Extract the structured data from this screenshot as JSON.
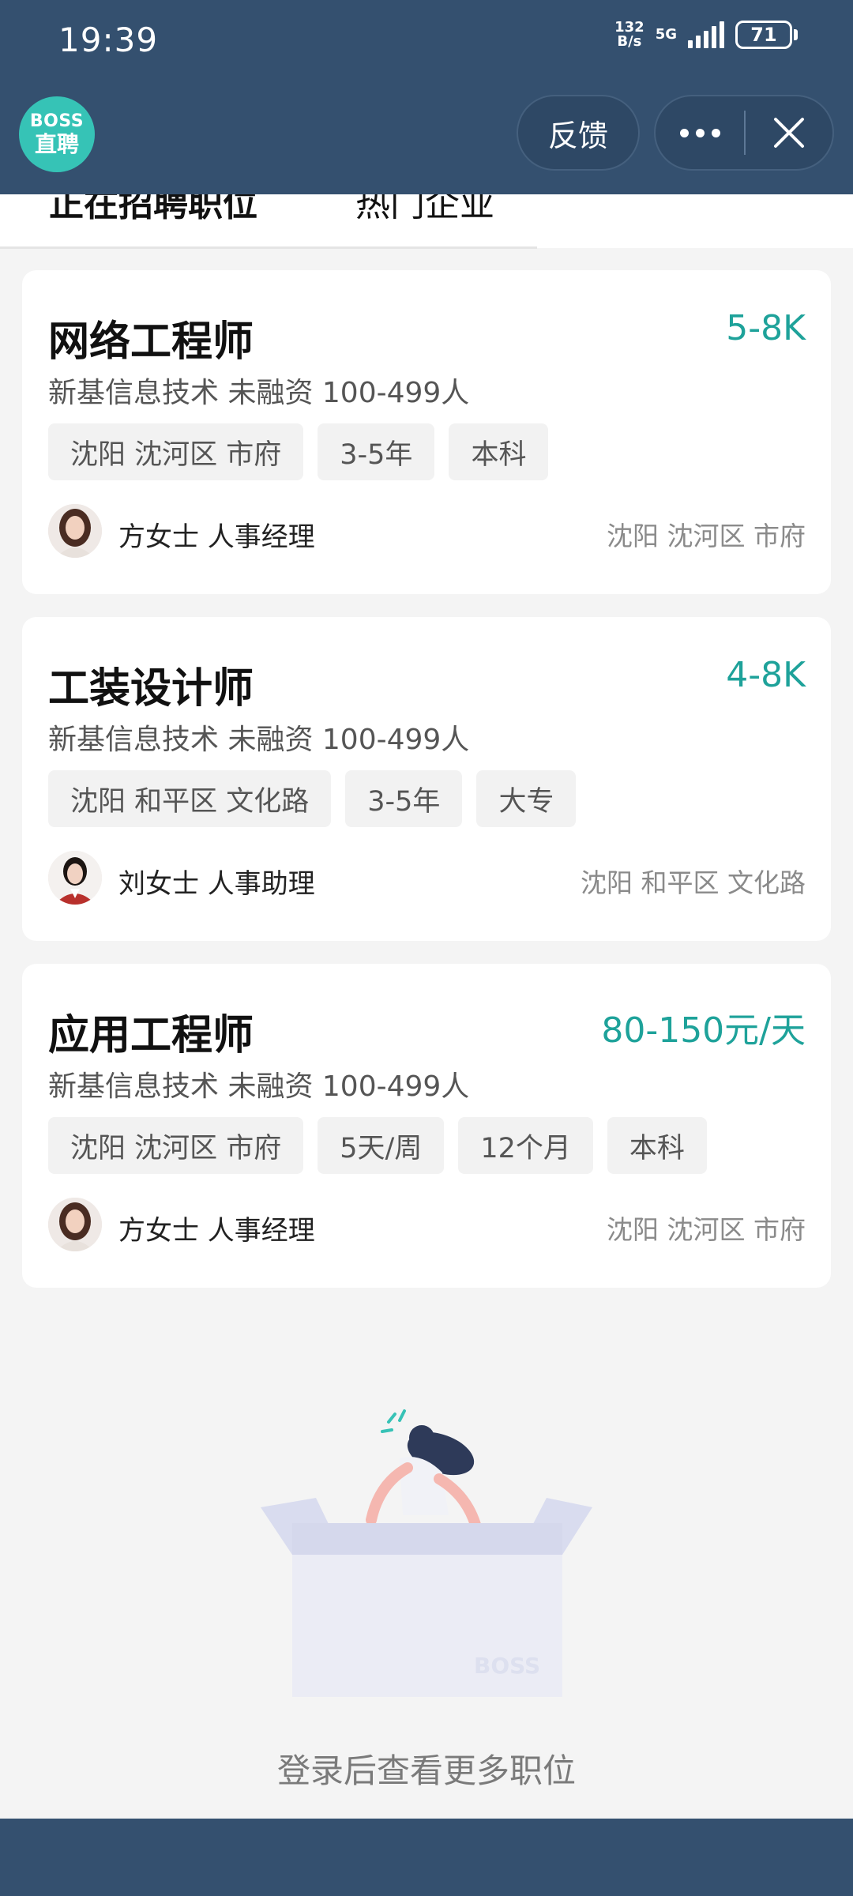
{
  "status_bar": {
    "time": "19:39",
    "net_speed_top": "132",
    "net_speed_bottom": "B/s",
    "network": "5G",
    "battery": "71"
  },
  "header": {
    "logo_line1": "BOSS",
    "logo_line2": "直聘",
    "feedback_label": "反馈",
    "more_icon": "more-dots-icon",
    "close_icon": "close-icon"
  },
  "tabs": [
    {
      "label": "正在招聘职位",
      "active": true
    },
    {
      "label": "热门企业",
      "active": false
    }
  ],
  "jobs": [
    {
      "title": "网络工程师",
      "salary": "5-8K",
      "company": "新基信息技术 未融资 100-499人",
      "tags": [
        "沈阳 沈河区 市府",
        "3-5年",
        "本科"
      ],
      "recruiter": "方女士 人事经理",
      "location": "沈阳 沈河区 市府"
    },
    {
      "title": "工装设计师",
      "salary": "4-8K",
      "company": "新基信息技术 未融资 100-499人",
      "tags": [
        "沈阳 和平区 文化路",
        "3-5年",
        "大专"
      ],
      "recruiter": "刘女士 人事助理",
      "location": "沈阳 和平区 文化路"
    },
    {
      "title": "应用工程师",
      "salary": "80-150元/天",
      "company": "新基信息技术 未融资 100-499人",
      "tags": [
        "沈阳 沈河区 市府",
        "5天/周",
        "12个月",
        "本科"
      ],
      "recruiter": "方女士 人事经理",
      "location": "沈阳 沈河区 市府"
    }
  ],
  "empty_state": {
    "box_label": "BOSS",
    "hint": "登录后查看更多职位"
  },
  "colors": {
    "header_bg": "#34506f",
    "accent": "#1ea29a",
    "logo": "#36c3b6"
  }
}
